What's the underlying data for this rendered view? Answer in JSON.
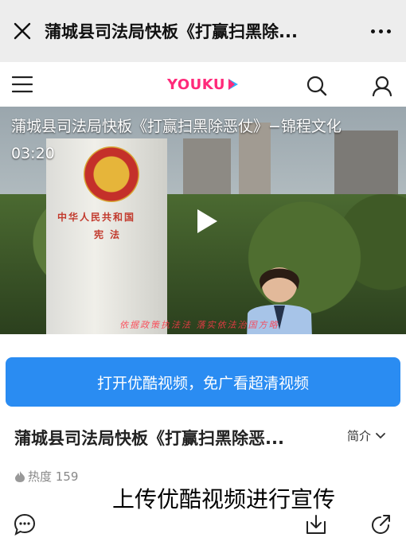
{
  "topbar": {
    "close_icon": "close-icon",
    "title": "蒲城县司法局快板《打赢扫黑除...",
    "more_icon": "more-icon"
  },
  "nav": {
    "menu_icon": "menu-icon",
    "logo_text": "YOUKU",
    "search_icon": "search-icon",
    "user_icon": "user-icon",
    "brand_color": "#ff2a7a"
  },
  "video": {
    "title": "蒲城县司法局快板《打赢扫黑除恶仗》−锦程文化",
    "duration": "03:20",
    "monument_line1": "中华人民共和国",
    "monument_line2": "宪法",
    "caption": "依据政策执法法    落实依法治国方略"
  },
  "open_app_button": {
    "label": "打开优酷视频，免广看超清视频",
    "color": "#2a8cf2"
  },
  "detail": {
    "video_name": "蒲城县司法局快板《打赢扫黑除恶...",
    "intro_label": "简介",
    "heat_label": "热度 159"
  },
  "overlay_text": "上传优酷视频进行宣传",
  "bottom_bar": {
    "comment_icon": "comment-icon",
    "download_icon": "download-icon",
    "share_icon": "share-icon"
  }
}
